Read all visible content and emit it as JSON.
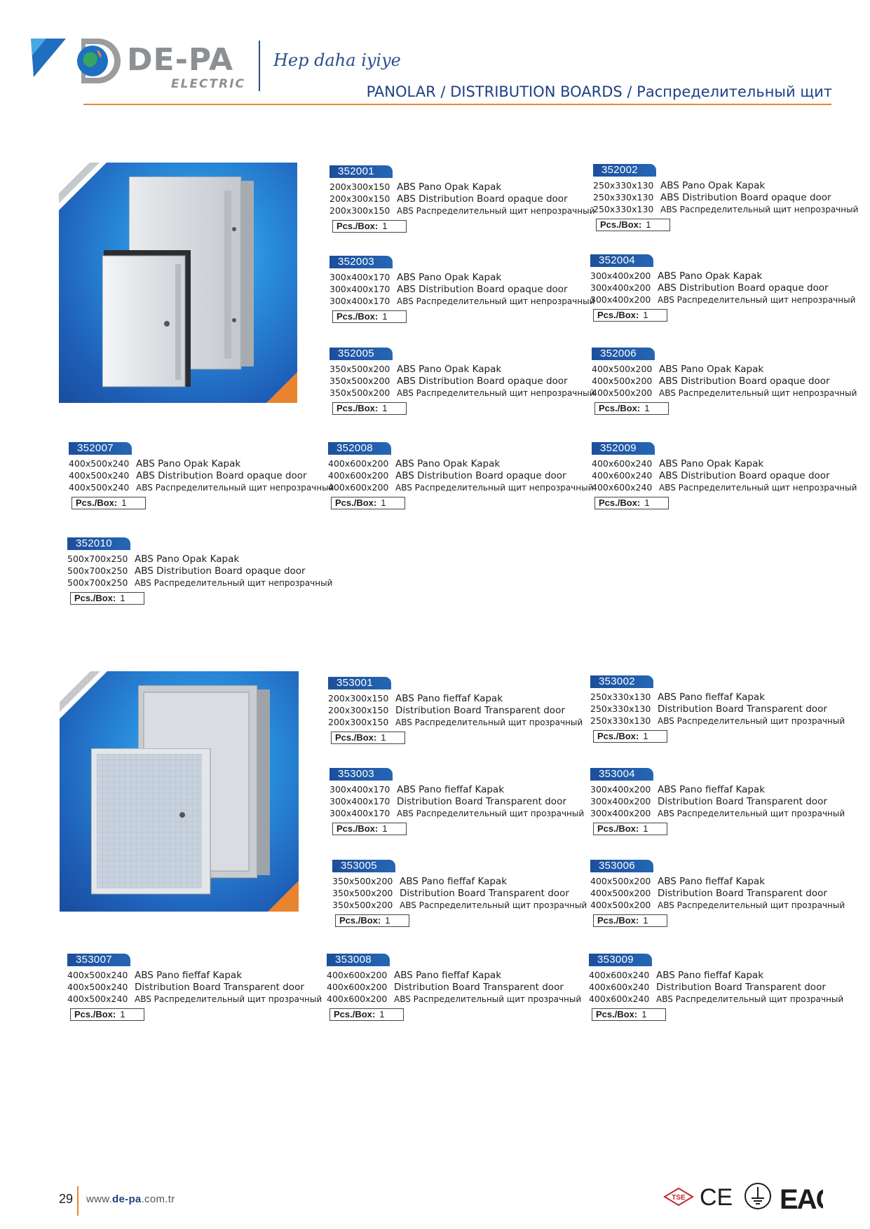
{
  "header": {
    "brand_name": "DE-PA",
    "brand_sub": "ELECTRIC",
    "slogan": "Hep daha iyiye",
    "page_title": "PANOLAR / DISTRIBUTION BOARDS / Распределительный щит"
  },
  "colors": {
    "brand_blue": "#1f3f84",
    "accent_orange": "#e8842f",
    "tag_blue": "#1c4f9c"
  },
  "section_opaque": {
    "photo_alt": "opaque-door-distribution-boards-photo",
    "products": [
      {
        "code": "352001",
        "lines": [
          {
            "dim": "200x300x150",
            "text": "ABS Pano Opak Kapak"
          },
          {
            "dim": "200x300x150",
            "text": "ABS Distribution Board opaque door"
          },
          {
            "dim": "200x300x150",
            "text": "ABS  Распределительный щит непрозрачный"
          }
        ],
        "pcs_label": "Pcs./Box:",
        "pcs_value": "1"
      },
      {
        "code": "352002",
        "lines": [
          {
            "dim": "250x330x130",
            "text": "ABS Pano Opak Kapak"
          },
          {
            "dim": "250x330x130",
            "text": "ABS Distribution Board opaque door"
          },
          {
            "dim": "250x330x130",
            "text": "ABS  Распределительный щит непрозрачный"
          }
        ],
        "pcs_label": "Pcs./Box:",
        "pcs_value": "1"
      },
      {
        "code": "352003",
        "lines": [
          {
            "dim": "300x400x170",
            "text": "ABS Pano Opak Kapak"
          },
          {
            "dim": "300x400x170",
            "text": "ABS Distribution Board opaque door"
          },
          {
            "dim": "300x400x170",
            "text": "ABS  Распределительный щит непрозрачный"
          }
        ],
        "pcs_label": "Pcs./Box:",
        "pcs_value": "1"
      },
      {
        "code": "352004",
        "lines": [
          {
            "dim": "300x400x200",
            "text": "ABS Pano Opak Kapak"
          },
          {
            "dim": "300x400x200",
            "text": "ABS Distribution Board opaque door"
          },
          {
            "dim": "300x400x200",
            "text": "ABS  Распределительный щит непрозрачный"
          }
        ],
        "pcs_label": "Pcs./Box:",
        "pcs_value": "1"
      },
      {
        "code": "352005",
        "lines": [
          {
            "dim": "350x500x200",
            "text": "ABS Pano Opak Kapak"
          },
          {
            "dim": "350x500x200",
            "text": "ABS Distribution Board opaque door"
          },
          {
            "dim": "350x500x200",
            "text": "ABS  Распределительный щит непрозрачный"
          }
        ],
        "pcs_label": "Pcs./Box:",
        "pcs_value": "1"
      },
      {
        "code": "352006",
        "lines": [
          {
            "dim": "400x500x200",
            "text": "ABS Pano Opak Kapak"
          },
          {
            "dim": "400x500x200",
            "text": "ABS Distribution Board opaque door"
          },
          {
            "dim": "400x500x200",
            "text": "ABS  Распределительный щит непрозрачный"
          }
        ],
        "pcs_label": "Pcs./Box:",
        "pcs_value": "1"
      },
      {
        "code": "352007",
        "lines": [
          {
            "dim": "400x500x240",
            "text": "ABS Pano Opak Kapak"
          },
          {
            "dim": "400x500x240",
            "text": "ABS Distribution Board opaque door"
          },
          {
            "dim": "400x500x240",
            "text": "ABS  Распределительный щит непрозрачный"
          }
        ],
        "pcs_label": "Pcs./Box:",
        "pcs_value": "1"
      },
      {
        "code": "352008",
        "lines": [
          {
            "dim": "400x600x200",
            "text": "ABS Pano Opak Kapak"
          },
          {
            "dim": "400x600x200",
            "text": "ABS Distribution Board opaque door"
          },
          {
            "dim": "400x600x200",
            "text": "ABS  Распределительный щит непрозрачный"
          }
        ],
        "pcs_label": "Pcs./Box:",
        "pcs_value": "1"
      },
      {
        "code": "352009",
        "lines": [
          {
            "dim": "400x600x240",
            "text": "ABS Pano Opak Kapak"
          },
          {
            "dim": "400x600x240",
            "text": "ABS Distribution Board opaque door"
          },
          {
            "dim": "400x600x240",
            "text": "ABS  Распределительный щит непрозрачный"
          }
        ],
        "pcs_label": "Pcs./Box:",
        "pcs_value": "1"
      },
      {
        "code": "352010",
        "lines": [
          {
            "dim": "500x700x250",
            "text": "ABS Pano Opak Kapak"
          },
          {
            "dim": "500x700x250",
            "text": "ABS Distribution Board opaque door"
          },
          {
            "dim": "500x700x250",
            "text": "ABS  Распределительный щит непрозрачный"
          }
        ],
        "pcs_label": "Pcs./Box:",
        "pcs_value": "1"
      }
    ]
  },
  "section_transparent": {
    "photo_alt": "transparent-door-distribution-boards-photo",
    "products": [
      {
        "code": "353001",
        "lines": [
          {
            "dim": "200x300x150",
            "text": "ABS Pano fieffaf Kapak"
          },
          {
            "dim": "200x300x150",
            "text": "Distribution Board Transparent door"
          },
          {
            "dim": "200x300x150",
            "text": "ABS  Распределительный щит  прозрачный"
          }
        ],
        "pcs_label": "Pcs./Box:",
        "pcs_value": "1"
      },
      {
        "code": "353002",
        "lines": [
          {
            "dim": "250x330x130",
            "text": "ABS Pano fieffaf Kapak"
          },
          {
            "dim": "250x330x130",
            "text": "Distribution Board Transparent door"
          },
          {
            "dim": "250x330x130",
            "text": "ABS  Распределительный щит  прозрачный"
          }
        ],
        "pcs_label": "Pcs./Box:",
        "pcs_value": "1"
      },
      {
        "code": "353003",
        "lines": [
          {
            "dim": "300x400x170",
            "text": "ABS Pano fieffaf Kapak"
          },
          {
            "dim": "300x400x170",
            "text": "Distribution Board Transparent door"
          },
          {
            "dim": "300x400x170",
            "text": "ABS  Распределительный щит  прозрачный"
          }
        ],
        "pcs_label": "Pcs./Box:",
        "pcs_value": "1"
      },
      {
        "code": "353004",
        "lines": [
          {
            "dim": "300x400x200",
            "text": "ABS Pano fieffaf Kapak"
          },
          {
            "dim": "300x400x200",
            "text": "Distribution Board Transparent door"
          },
          {
            "dim": "300x400x200",
            "text": "ABS  Распределительный щит  прозрачный"
          }
        ],
        "pcs_label": "Pcs./Box:",
        "pcs_value": "1"
      },
      {
        "code": "353005",
        "lines": [
          {
            "dim": "350x500x200",
            "text": "ABS Pano fieffaf Kapak"
          },
          {
            "dim": "350x500x200",
            "text": "Distribution Board Transparent door"
          },
          {
            "dim": "350x500x200",
            "text": "ABS  Распределительный щит  прозрачный"
          }
        ],
        "pcs_label": "Pcs./Box:",
        "pcs_value": "1"
      },
      {
        "code": "353006",
        "lines": [
          {
            "dim": "400x500x200",
            "text": "ABS Pano fieffaf Kapak"
          },
          {
            "dim": "400x500x200",
            "text": "Distribution Board Transparent door"
          },
          {
            "dim": "400x500x200",
            "text": "ABS  Распределительный щит  прозрачный"
          }
        ],
        "pcs_label": "Pcs./Box:",
        "pcs_value": "1"
      },
      {
        "code": "353007",
        "lines": [
          {
            "dim": "400x500x240",
            "text": "ABS Pano fieffaf Kapak"
          },
          {
            "dim": "400x500x240",
            "text": "Distribution Board Transparent door"
          },
          {
            "dim": "400x500x240",
            "text": "ABS  Распределительный щит  прозрачный"
          }
        ],
        "pcs_label": "Pcs./Box:",
        "pcs_value": "1"
      },
      {
        "code": "353008",
        "lines": [
          {
            "dim": "400x600x200",
            "text": "ABS Pano fieffaf Kapak"
          },
          {
            "dim": "400x600x200",
            "text": "Distribution Board Transparent door"
          },
          {
            "dim": "400x600x200",
            "text": "ABS  Распределительный щит  прозрачный"
          }
        ],
        "pcs_label": "Pcs./Box:",
        "pcs_value": "1"
      },
      {
        "code": "353009",
        "lines": [
          {
            "dim": "400x600x240",
            "text": "ABS Pano fieffaf Kapak"
          },
          {
            "dim": "400x600x240",
            "text": "Distribution Board Transparent door"
          },
          {
            "dim": "400x600x240",
            "text": "ABS  Распределительный щит  прозрачный"
          }
        ],
        "pcs_label": "Pcs./Box:",
        "pcs_value": "1"
      }
    ]
  },
  "footer": {
    "page_number": "29",
    "website_prefix": "www.",
    "website_domain": "de-pa",
    "website_suffix": ".com.tr",
    "cert_tse": "TSE",
    "cert_ce": "CE",
    "cert_eac": "EAC"
  }
}
